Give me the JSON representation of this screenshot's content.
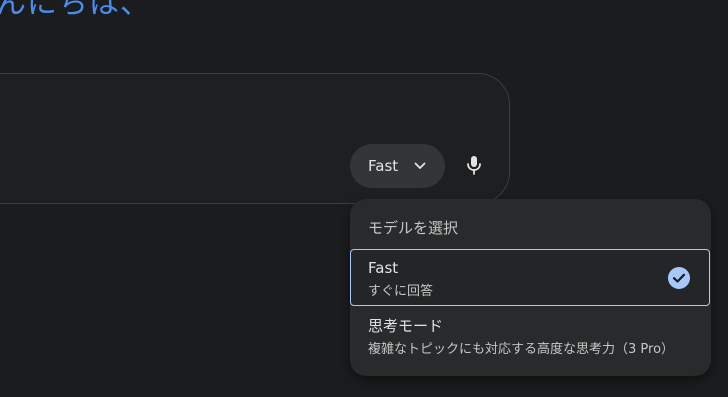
{
  "greeting": "んにちは、",
  "prompt": {
    "model_selector_label": "Fast",
    "chevron_icon": "chevron-down-icon",
    "mic_icon": "microphone-icon"
  },
  "model_menu": {
    "header": "モデルを選択",
    "options": [
      {
        "title": "Fast",
        "subtitle": "すぐに回答",
        "selected": true
      },
      {
        "title": "思考モード",
        "subtitle": "複雑なトピックにも対応する高度な思考力（3 Pro）",
        "selected": false
      }
    ]
  },
  "colors": {
    "background": "#1b1c1d",
    "accent_blue": "#4a8df0",
    "selected_border": "#a8c7fa",
    "check_fill": "#a8c7fa"
  }
}
